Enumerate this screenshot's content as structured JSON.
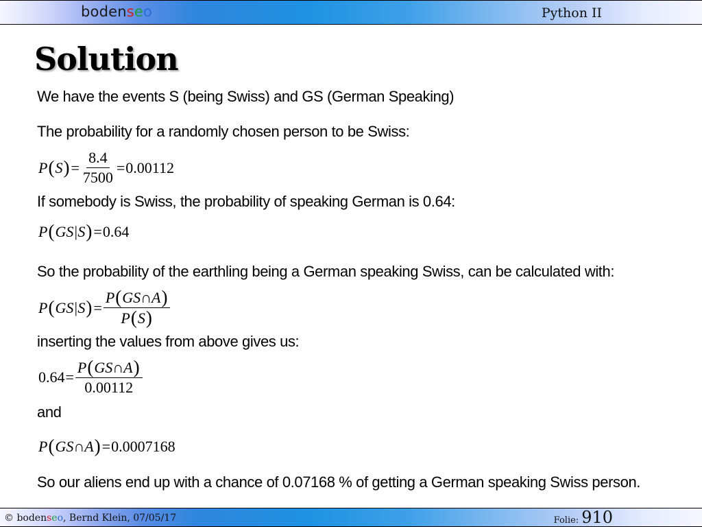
{
  "header": {
    "logo_brand": "bodenseo",
    "logo_part1": "boden",
    "logo_s": "s",
    "logo_e": "e",
    "logo_o": "o",
    "course": "Python II"
  },
  "title": "Solution",
  "paragraphs": {
    "p1": "We have the events S (being Swiss) and GS (German Speaking)",
    "p2": "The probability for a randomly chosen person to be Swiss:",
    "p3": "If somebody is Swiss, the probability of speaking German is 0.64:",
    "p4": "So the probability of the earthling being a German speaking Swiss, can be calculated with:",
    "p5": "inserting the values from above gives us:",
    "p6": "and",
    "p7": "So our aliens end up with a chance of 0.07168 % of getting a German speaking Swiss person."
  },
  "formulas": {
    "f1": {
      "lhs_fn": "P",
      "lhs_arg": "S",
      "num": "8.4",
      "den": "7500",
      "result": "0.00112"
    },
    "f2": {
      "fn": "P",
      "arg": "GS|S",
      "result": "0.64"
    },
    "f3": {
      "lhs_fn": "P",
      "lhs_arg": "GS|S",
      "num_fn": "P",
      "num_arg": "GS∩A",
      "den_fn": "P",
      "den_arg": "S"
    },
    "f4": {
      "lhs": "0.64",
      "num_fn": "P",
      "num_arg": "GS∩A",
      "den": "0.00112"
    },
    "f5": {
      "fn": "P",
      "arg": "GS∩A",
      "result": "0.0007168"
    }
  },
  "footer": {
    "copyright": "©",
    "brand_part1": "boden",
    "brand_s": "s",
    "brand_e": "e",
    "brand_o": "o",
    "author_date": ", Bernd Klein, 07/05/17",
    "slide_label": "Folie:",
    "slide_number": "910"
  }
}
